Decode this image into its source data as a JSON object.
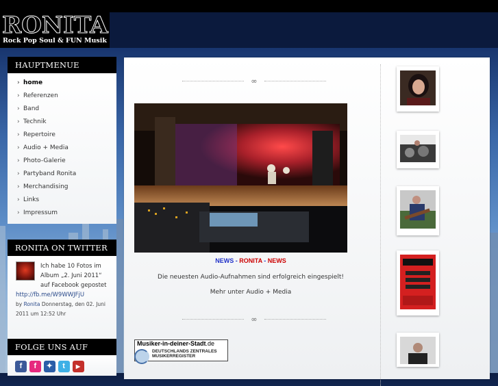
{
  "logo": {
    "title": "RONITA",
    "subtitle": "Rock Pop Soul & FUN Musik"
  },
  "menu": {
    "heading": "HAUPTMENUE",
    "items": [
      {
        "label": "home",
        "active": true
      },
      {
        "label": "Referenzen"
      },
      {
        "label": "Band"
      },
      {
        "label": "Technik"
      },
      {
        "label": "Repertoire"
      },
      {
        "label": "Audio + Media"
      },
      {
        "label": "Photo-Galerie"
      },
      {
        "label": "Partyband Ronita"
      },
      {
        "label": "Merchandising"
      },
      {
        "label": "Links"
      },
      {
        "label": "Impressum"
      }
    ],
    "arrow": "›"
  },
  "twitter": {
    "heading": "RONITA ON TWITTER",
    "tweet_text": "Ich habe 10 Fotos im Album „2. Juni 2011“ auf Facebook gepostet",
    "tweet_link": "http://fb.me/W9WWJFjU",
    "by": "by",
    "author": "Ronita",
    "date": "Donnerstag, den 02. Juni 2011 um 12:52 Uhr"
  },
  "follow": {
    "heading": "FOLGE UNS AUF",
    "icons": [
      {
        "name": "facebook-icon",
        "glyph": "f",
        "color": "#3b5998"
      },
      {
        "name": "flickr-icon",
        "glyph": "f",
        "color": "#e6287e"
      },
      {
        "name": "myspace-icon",
        "glyph": "✦",
        "color": "#2b5ea8"
      },
      {
        "name": "twitter-icon",
        "glyph": "t",
        "color": "#3eb0e6"
      },
      {
        "name": "youtube-icon",
        "glyph": "▶",
        "color": "#c4302b"
      }
    ]
  },
  "news": {
    "title_a": "NEWS",
    "sep": " - ",
    "title_b": "RONITA",
    "title_c": "NEWS",
    "text": "Die neuesten Audio-Aufnahmen sind erfolgreich eingespielt!",
    "more": "Mehr unter Audio + Media"
  },
  "badge": {
    "site": "Musiker-in-deiner-Stadt",
    "tld": ".de",
    "line1": "DEUTSCHLANDS ZENTRALES",
    "line2": "MUSIKERREGISTER"
  },
  "colors": {
    "menu_head": "#000000",
    "news_blue": "#2031c8",
    "news_red": "#cc0000"
  }
}
